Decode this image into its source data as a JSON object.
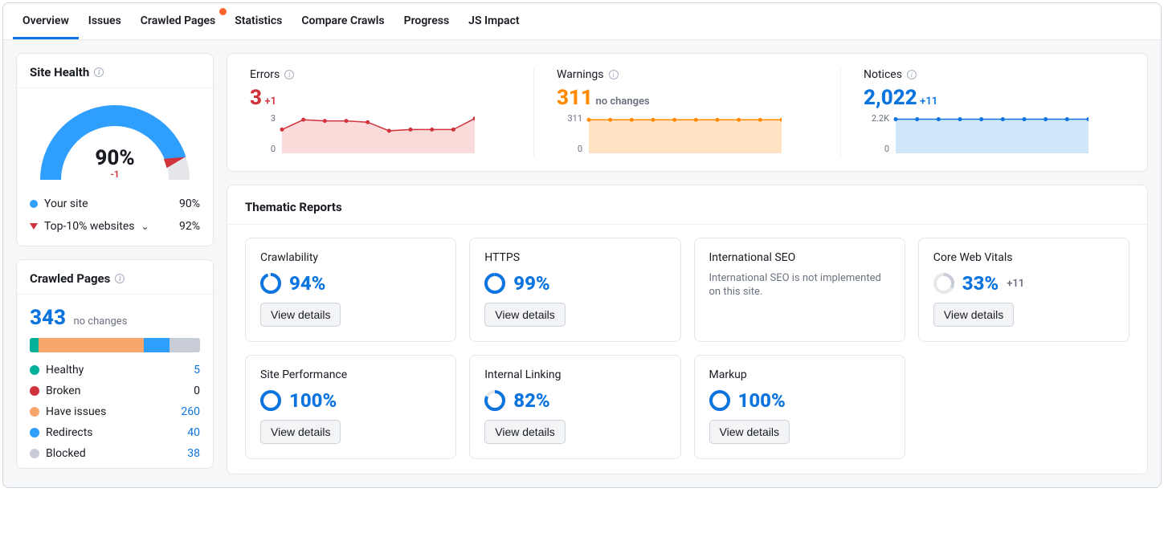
{
  "tabs": {
    "items": [
      {
        "label": "Overview",
        "active": true,
        "badge": false
      },
      {
        "label": "Issues",
        "active": false,
        "badge": false
      },
      {
        "label": "Crawled Pages",
        "active": false,
        "badge": true
      },
      {
        "label": "Statistics",
        "active": false,
        "badge": false
      },
      {
        "label": "Compare Crawls",
        "active": false,
        "badge": false
      },
      {
        "label": "Progress",
        "active": false,
        "badge": false
      },
      {
        "label": "JS Impact",
        "active": false,
        "badge": false
      }
    ]
  },
  "site_health": {
    "title": "Site Health",
    "score": "90%",
    "score_value": 90,
    "delta": "-1",
    "rows": [
      {
        "kind": "dot",
        "color": "#2e9fff",
        "label": "Your site",
        "value": "90%"
      },
      {
        "kind": "tri",
        "color": "#d1333c",
        "label": "Top-10% websites",
        "value": "92%",
        "chev": true
      }
    ]
  },
  "crawled": {
    "title": "Crawled Pages",
    "total": "343",
    "sub": "no changes",
    "rows": [
      {
        "color": "#00b09b",
        "label": "Healthy",
        "value": "5",
        "link": true
      },
      {
        "color": "#d1333c",
        "label": "Broken",
        "value": "0",
        "link": false
      },
      {
        "color": "#f9a66c",
        "label": "Have issues",
        "value": "260",
        "link": true
      },
      {
        "color": "#2e9fff",
        "label": "Redirects",
        "value": "40",
        "link": true
      },
      {
        "color": "#c7ccd6",
        "label": "Blocked",
        "value": "38",
        "link": true
      }
    ]
  },
  "metrics": [
    {
      "id": "errors",
      "title": "Errors",
      "value": "3",
      "delta": "+1",
      "color": "#d1333c",
      "fill": "#fbdada",
      "y0": "0",
      "y1": "3",
      "chart": {
        "values": [
          1.8,
          2.6,
          2.5,
          2.5,
          2.4,
          1.7,
          1.8,
          1.8,
          1.8,
          2.7
        ],
        "ymax": 3
      }
    },
    {
      "id": "warnings",
      "title": "Warnings",
      "value": "311",
      "delta": "no changes",
      "color": "#ff8a00",
      "fill": "#ffe3c2",
      "y0": "0",
      "y1": "311",
      "chart": {
        "values": [
          311,
          311,
          311,
          311,
          311,
          311,
          311,
          311,
          311,
          311
        ],
        "ymax": 360
      }
    },
    {
      "id": "notices",
      "title": "Notices",
      "value": "2,022",
      "delta": "+11",
      "color": "#0b74de",
      "fill": "#cfe6fb",
      "y0": "0",
      "y1": "2.2K",
      "chart": {
        "values": [
          2022,
          2022,
          2022,
          2022,
          2022,
          2022,
          2022,
          2022,
          2022,
          2022
        ],
        "ymax": 2300
      }
    }
  ],
  "thematic": {
    "title": "Thematic Reports",
    "view_details": "View details",
    "cards": [
      {
        "title": "Crawlability",
        "pct": "94%",
        "value": 94,
        "button": true
      },
      {
        "title": "HTTPS",
        "pct": "99%",
        "value": 99,
        "button": true
      },
      {
        "title": "International SEO",
        "msg": "International SEO is not implemented on this site."
      },
      {
        "title": "Core Web Vitals",
        "pct": "33%",
        "value": 33,
        "delta": "+11",
        "button": true,
        "gray": true
      },
      {
        "title": "Site Performance",
        "pct": "100%",
        "value": 100,
        "button": true
      },
      {
        "title": "Internal Linking",
        "pct": "82%",
        "value": 82,
        "button": true
      },
      {
        "title": "Markup",
        "pct": "100%",
        "value": 100,
        "button": true
      }
    ]
  },
  "colors": {
    "blue": "#2e9fff",
    "accent": "#0b74de",
    "red": "#d1333c",
    "orange": "#ff8a00",
    "green": "#00b09b",
    "gray": "#c7ccd6"
  },
  "chart_data": {
    "type": "line",
    "series": [
      {
        "name": "Errors",
        "values": [
          1.8,
          2.6,
          2.5,
          2.5,
          2.4,
          1.7,
          1.8,
          1.8,
          1.8,
          2.7
        ],
        "ymax": 3
      },
      {
        "name": "Warnings",
        "values": [
          311,
          311,
          311,
          311,
          311,
          311,
          311,
          311,
          311,
          311
        ],
        "ymax": 360
      },
      {
        "name": "Notices",
        "values": [
          2022,
          2022,
          2022,
          2022,
          2022,
          2022,
          2022,
          2022,
          2022,
          2022
        ],
        "ymax": 2300
      }
    ]
  }
}
